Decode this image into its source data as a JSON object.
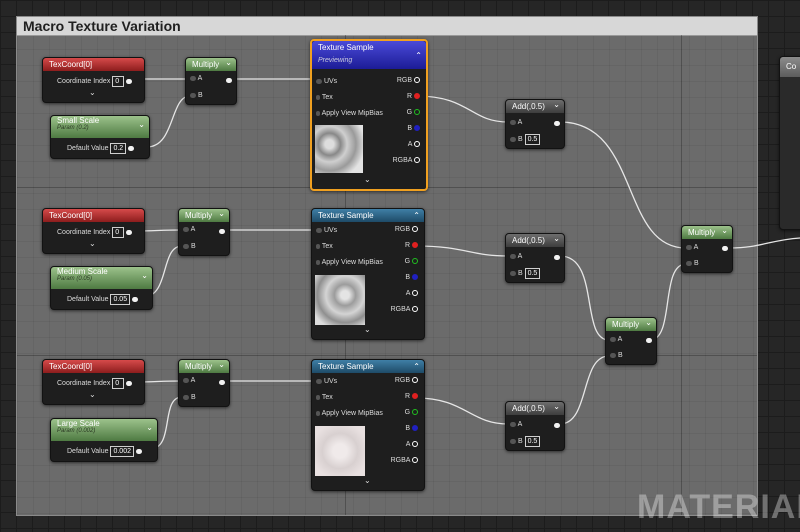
{
  "comment": {
    "title": "Macro Texture Variation"
  },
  "offscreen_node": {
    "label": "Co"
  },
  "texcoord_nodes": [
    {
      "title": "TexCoord[0]",
      "field_label": "Coordinate Index",
      "value": "0"
    },
    {
      "title": "TexCoord[0]",
      "field_label": "Coordinate Index",
      "value": "0"
    },
    {
      "title": "TexCoord[0]",
      "field_label": "Coordinate Index",
      "value": "0"
    }
  ],
  "scale_params": [
    {
      "title": "Small Scale",
      "subtitle": "Param (0.2)",
      "field_label": "Default Value",
      "value": "0.2"
    },
    {
      "title": "Medium Scale",
      "subtitle": "Param (0.05)",
      "field_label": "Default Value",
      "value": "0.05"
    },
    {
      "title": "Large Scale",
      "subtitle": "Param (0.002)",
      "field_label": "Default Value",
      "value": "0.002"
    }
  ],
  "multiply": {
    "title": "Multiply",
    "pin_a": "A",
    "pin_b": "B"
  },
  "texture_samples": [
    {
      "title": "Texture Sample",
      "status": "Previewing"
    },
    {
      "title": "Texture Sample",
      "status": ""
    },
    {
      "title": "Texture Sample",
      "status": ""
    }
  ],
  "texture_pins": {
    "uvs": "UVs",
    "tex": "Tex",
    "mip": "Apply View MipBias",
    "rgb": "RGB",
    "r": "R",
    "g": "G",
    "b": "B",
    "a": "A",
    "rgba": "RGBA"
  },
  "add_nodes": [
    {
      "title": "Add(,0.5)",
      "pin_a": "A",
      "pin_b": "B",
      "b_value": "0.5"
    },
    {
      "title": "Add(,0.5)",
      "pin_a": "A",
      "pin_b": "B",
      "b_value": "0.5"
    },
    {
      "title": "Add(,0.5)",
      "pin_a": "A",
      "pin_b": "B",
      "b_value": "0.5"
    }
  ],
  "watermark": "MATERIAL",
  "colors": {
    "selected_border": "#f0a020",
    "wire": "#e8e8e8",
    "red_pin": "#e02020",
    "green_pin": "#20c020",
    "blue_pin": "#2020c0"
  }
}
